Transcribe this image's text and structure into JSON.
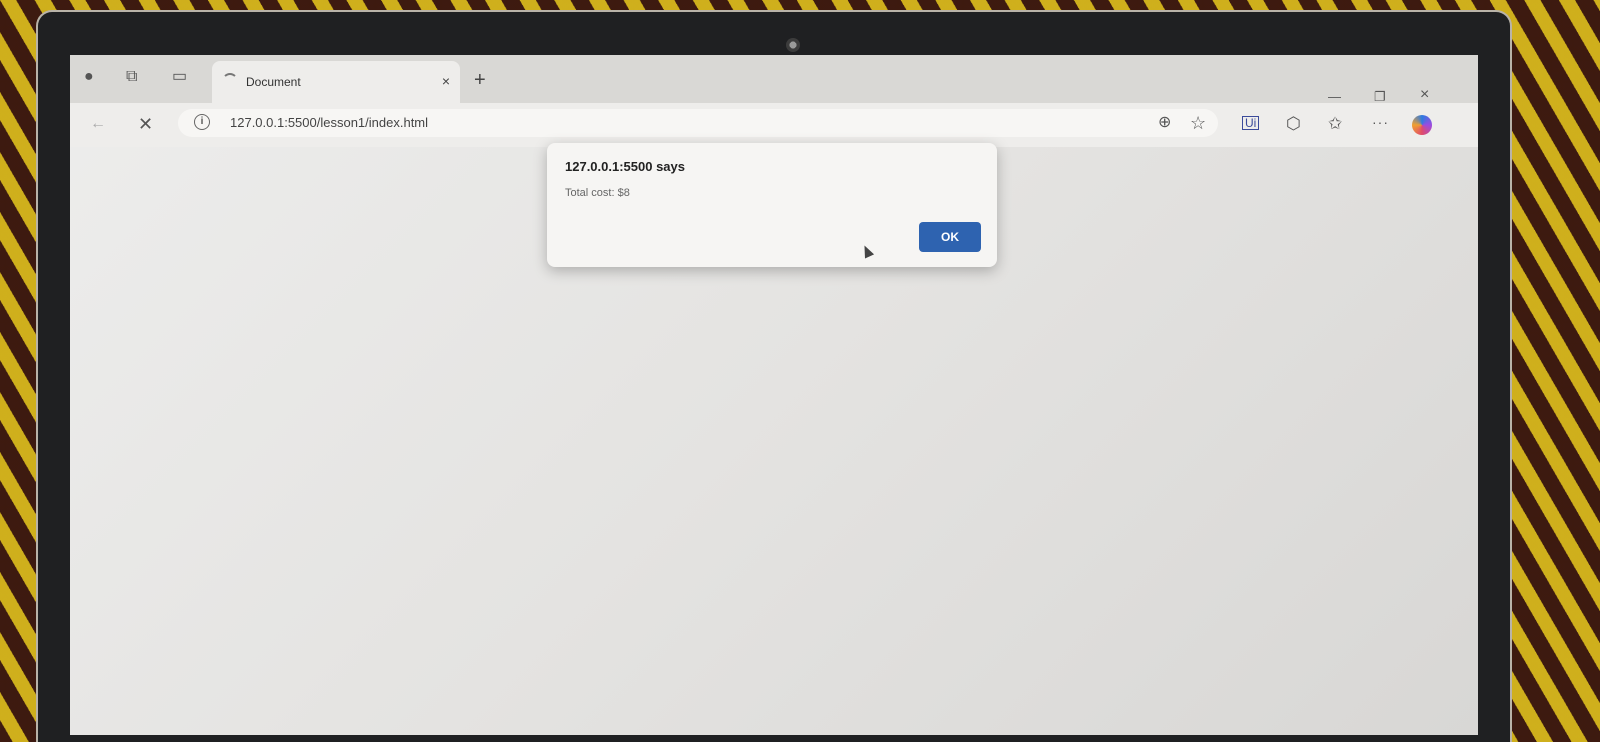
{
  "tab": {
    "title": "Document",
    "close": "×"
  },
  "newtab": "+",
  "window": {
    "minimize": "—",
    "maximize": "❐",
    "close": "×"
  },
  "toolbar": {
    "back": "←",
    "stop": "✕",
    "info": "i",
    "url": "127.0.0.1:5500/lesson1/index.html",
    "zoom": "⊕",
    "favorite": "☆",
    "ui_ext": "Ui",
    "extensions": "⬡",
    "favorites": "✩",
    "more": "···"
  },
  "dialog": {
    "title": "127.0.0.1:5500 says",
    "message": "Total cost: $8",
    "ok_label": "OK"
  }
}
